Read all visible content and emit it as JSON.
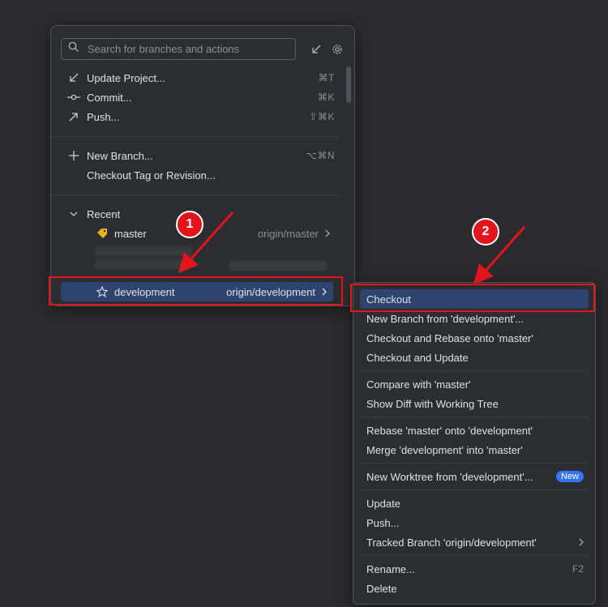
{
  "popup": {
    "search_placeholder": "Search for branches and actions",
    "actions": [
      {
        "label": "Update Project...",
        "shortcut": "⌘T"
      },
      {
        "label": "Commit...",
        "shortcut": "⌘K"
      },
      {
        "label": "Push...",
        "shortcut": "⇧⌘K"
      },
      {
        "label": "New Branch...",
        "shortcut": "⌥⌘N"
      },
      {
        "label": "Checkout Tag or Revision...",
        "shortcut": ""
      }
    ],
    "recent_label": "Recent",
    "branches": [
      {
        "name": "master",
        "tracking": "origin/master"
      },
      {
        "name": "development",
        "tracking": "origin/development"
      }
    ]
  },
  "menu": {
    "items": [
      {
        "label": "Checkout"
      },
      {
        "label": "New Branch from 'development'..."
      },
      {
        "label": "Checkout and Rebase onto 'master'"
      },
      {
        "label": "Checkout and Update"
      },
      {
        "label": "Compare with 'master'"
      },
      {
        "label": "Show Diff with Working Tree"
      },
      {
        "label": "Rebase 'master' onto 'development'"
      },
      {
        "label": "Merge 'development' into 'master'"
      },
      {
        "label": "New Worktree from 'development'...",
        "badge": "New"
      },
      {
        "label": "Update"
      },
      {
        "label": "Push..."
      },
      {
        "label": "Tracked Branch 'origin/development'"
      },
      {
        "label": "Rename...",
        "shortcut": "F2"
      },
      {
        "label": "Delete"
      }
    ]
  },
  "annotations": {
    "step1": "1",
    "step2": "2",
    "color": "#e3141c"
  },
  "colors": {
    "background": "#2b2b2d",
    "panel": "#2b2d30",
    "selection": "#2e436e",
    "accent_badge": "#3574f0"
  }
}
